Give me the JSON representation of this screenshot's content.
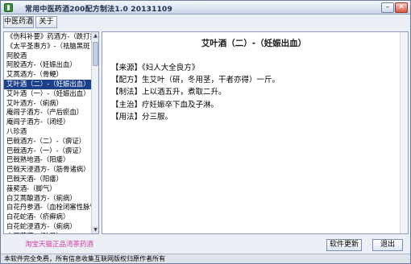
{
  "window": {
    "title": "常用中医药酒200配方制法1.0 20131109"
  },
  "toolbar": {
    "recipe_btn": "中医药酒",
    "about_btn": "关于"
  },
  "list": {
    "items": [
      "《伤科补要》药酒方-（跌打损",
      "《太平圣惠方》-（祛脑黑斑",
      "阿胶酒",
      "阿胶酒方-（妊娠出血）",
      "艾蒿酒方-（骨鲠）",
      "艾叶酒（二）-（妊娠出血）",
      "艾叶酒（一）-（妊娠出血）",
      "艾叶酒方-（痢病）",
      "庵闾子酒方-（产后瘀血）",
      "庵闾子酒方-（闭经）",
      "八珍酒",
      "巴戟酒方-（二）-（痹证）",
      "巴戟酒方-（一）-（痹证）",
      "巴戟熟地酒-（阳痿）",
      "巴戟天浸酒方-（筋骨诸病）",
      "巴戟天酒-（阳痿）",
      "菝葜酒-（脚气）",
      "白艾蒿酿酒方-（痢病）",
      "白花丹参酒-（血栓闭塞性脉管",
      "白花蛇酒-（疥癣病）",
      "白花蛇浸酒方-（痢病）",
      "白蒿花酒-（眩晕）"
    ],
    "selected_index": 5
  },
  "content": {
    "title": "艾叶酒（二）-（妊娠出血）",
    "lines": [
      "【来源】《妇人大全良方》",
      "【配方】生艾叶（研，冬用茎，干者亦得）一斤。",
      "【制法】上以酒五升，煮取二升。",
      "【主治】疗妊娠卒下血及子淋。",
      "【用法】分三服。"
    ]
  },
  "footer": {
    "link": "淘宝天猫正品湾茶药酒",
    "update_btn": "软件更新",
    "exit_btn": "退出",
    "status": "本软件完全免费，所有信息收集互联网版权归原作者所有"
  },
  "colors": {
    "selection": "#1b3f8b",
    "link": "#d53aa5",
    "app_icon": "#3c8f3f"
  }
}
